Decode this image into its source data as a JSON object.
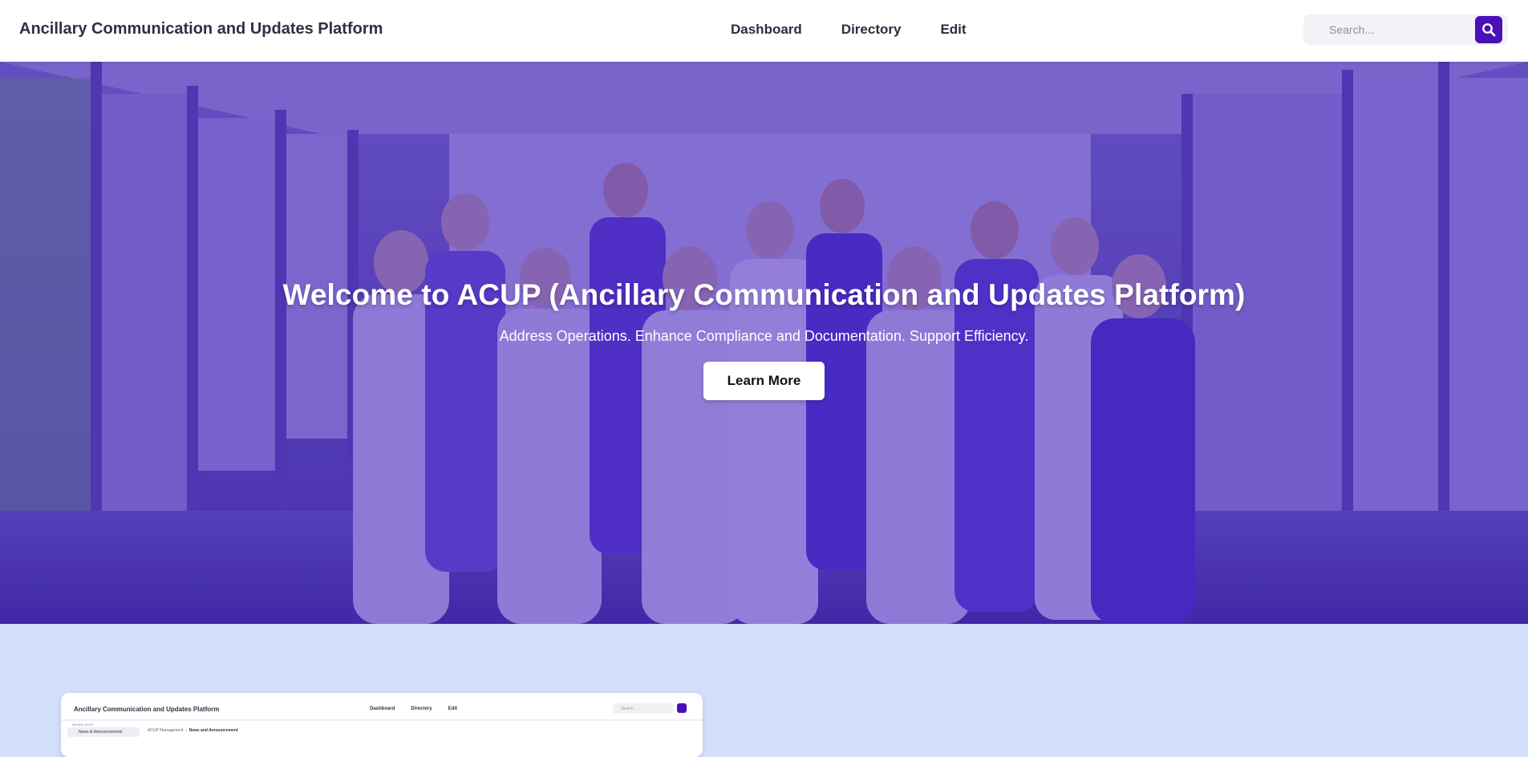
{
  "header": {
    "brand": "Ancillary Communication and Updates Platform",
    "nav": [
      {
        "label": "Dashboard"
      },
      {
        "label": "Directory"
      },
      {
        "label": "Edit"
      }
    ],
    "search": {
      "placeholder": "Search...",
      "button_icon": "search-icon"
    }
  },
  "hero": {
    "title": "Welcome to ACUP (Ancillary Communication and Updates Platform)",
    "subtitle": "Address Operations. Enhance Compliance and Documentation. Support Efficiency.",
    "cta_label": "Learn More",
    "image": "group-photo-of-healthcare-staff"
  },
  "preview": {
    "brand": "Ancillary Communication and Updates Platform",
    "nav": [
      "Dashboard",
      "Directory",
      "Edit"
    ],
    "search_placeholder": "Search...",
    "sidebar_caption": "Member ACUP",
    "sidebar_item": "News & Announcements",
    "breadcrumb": {
      "root": "ACUP Management",
      "current": "News and Announcement"
    }
  },
  "colors": {
    "accent": "#4a10b8",
    "hero_overlay": "#4623be",
    "page_background": "#d3dffb",
    "navbar": "#ffffff"
  }
}
